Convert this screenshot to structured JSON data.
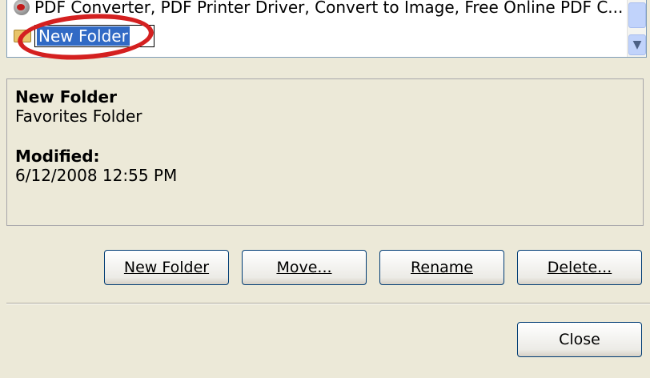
{
  "list": {
    "items": [
      {
        "label": "PDF Converter, PDF Printer Driver, Convert to Image, Free Online PDF C...",
        "icon": "ie-link-icon"
      },
      {
        "label": "New Folder",
        "icon": "folder-icon",
        "editing": true
      }
    ]
  },
  "details": {
    "name": "New Folder",
    "type": "Favorites Folder",
    "modified_label": "Modified:",
    "modified_value": "6/12/2008 12:55 PM"
  },
  "buttons": {
    "new_folder": "New Folder",
    "move": "Move...",
    "rename": "Rename",
    "delete": "Delete...",
    "close": "Close"
  },
  "colors": {
    "dialog_bg": "#ece9d8",
    "selection": "#316ac5",
    "highlight_circle": "#d42020"
  }
}
